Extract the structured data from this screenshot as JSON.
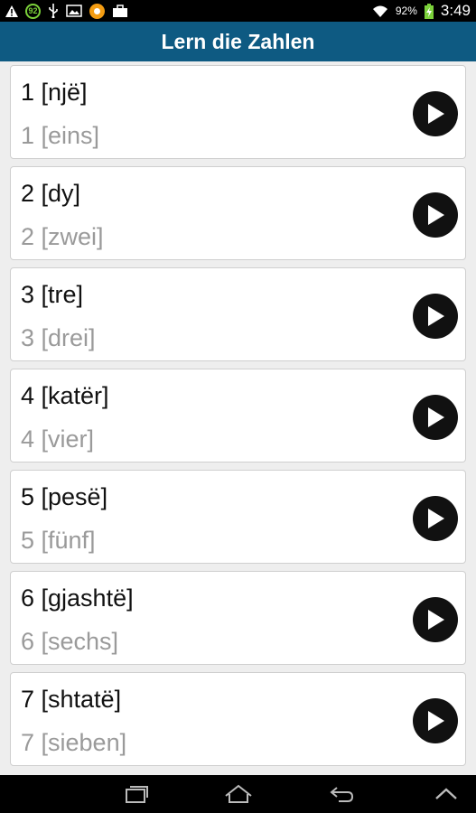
{
  "status_bar": {
    "badge_number": "92",
    "battery_percent": "92%",
    "time": "3:49",
    "icons": [
      "warning-icon",
      "usb-icon",
      "image-icon",
      "app-icon",
      "briefcase-icon",
      "wifi-icon",
      "battery-charging-icon"
    ]
  },
  "header": {
    "title": "Lern die Zahlen",
    "background_color": "#0e5a82"
  },
  "items": [
    {
      "primary": "1 [një]",
      "secondary": "1 [eins]"
    },
    {
      "primary": "2 [dy]",
      "secondary": "2 [zwei]"
    },
    {
      "primary": "3 [tre]",
      "secondary": "3 [drei]"
    },
    {
      "primary": "4 [katër]",
      "secondary": "4 [vier]"
    },
    {
      "primary": "5 [pesë]",
      "secondary": "5 [fünf]"
    },
    {
      "primary": "6 [gjashtë]",
      "secondary": "6 [sechs]"
    },
    {
      "primary": "7 [shtatë]",
      "secondary": "7 [sieben]"
    }
  ],
  "nav_bar": {
    "icons": [
      "recent-apps-icon",
      "home-icon",
      "back-icon",
      "collapse-icon"
    ]
  }
}
